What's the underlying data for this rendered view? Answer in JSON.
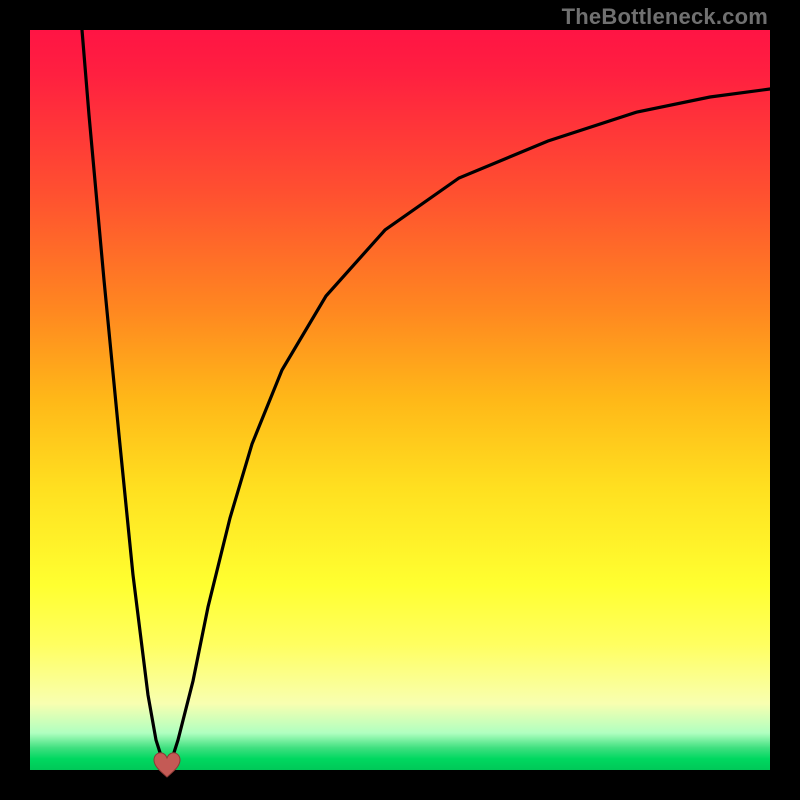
{
  "watermark": "TheBottleneck.com",
  "colors": {
    "frame_background": "#000000",
    "curve": "#000000",
    "heart": "#c45a55",
    "heart_outline": "#8c3a36",
    "watermark": "#707070"
  },
  "chart_data": {
    "type": "line",
    "title": "",
    "xlabel": "",
    "ylabel": "",
    "xlim": [
      0,
      100
    ],
    "ylim": [
      0,
      100
    ],
    "grid": false,
    "series": [
      {
        "name": "left-branch",
        "x": [
          7,
          8,
          10,
          12,
          14,
          16,
          17,
          18,
          18.5
        ],
        "y": [
          100,
          88,
          66,
          45,
          26,
          10,
          4,
          1,
          0
        ]
      },
      {
        "name": "right-branch",
        "x": [
          18.5,
          19,
          20,
          22,
          24,
          27,
          30,
          34,
          40,
          48,
          58,
          70,
          82,
          92,
          100
        ],
        "y": [
          0,
          1,
          4,
          12,
          22,
          34,
          44,
          54,
          64,
          73,
          80,
          85,
          89,
          91,
          92
        ]
      }
    ],
    "marker": {
      "name": "heart",
      "x": 18.5,
      "y": 0.5
    },
    "gradient_stops": [
      {
        "pos": 0,
        "color": "#ff1444"
      },
      {
        "pos": 22,
        "color": "#ff5030"
      },
      {
        "pos": 50,
        "color": "#ffb818"
      },
      {
        "pos": 75,
        "color": "#ffff30"
      },
      {
        "pos": 95,
        "color": "#b0ffc0"
      },
      {
        "pos": 100,
        "color": "#00c858"
      }
    ]
  }
}
